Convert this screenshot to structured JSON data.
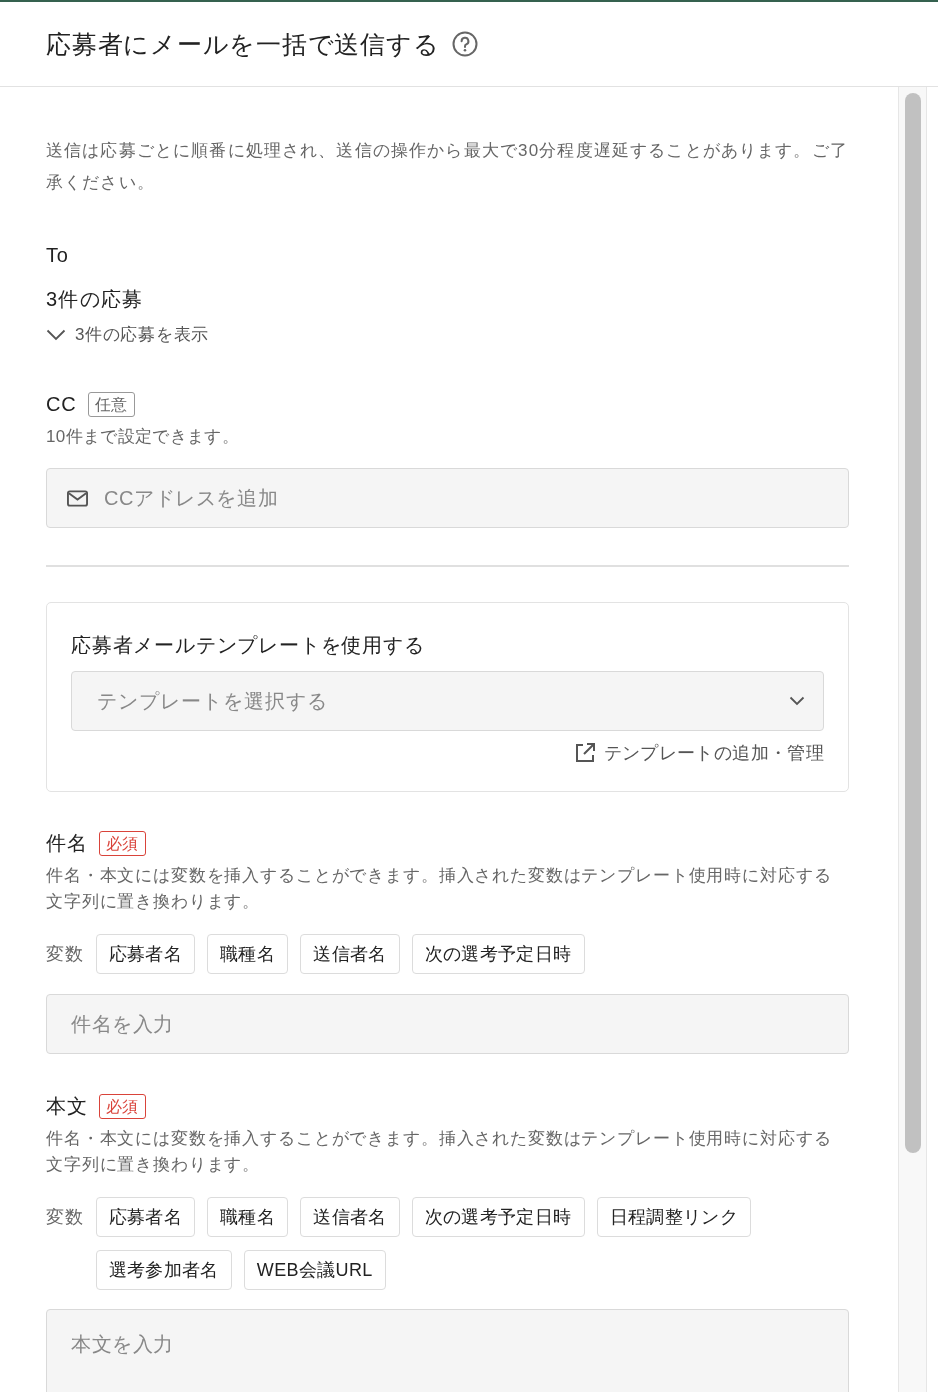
{
  "header": {
    "title": "応募者にメールを一括で送信する"
  },
  "notice": "送信は応募ごとに順番に処理され、送信の操作から最大で30分程度遅延することがあります。ご了承ください。",
  "to": {
    "label": "To",
    "summary": "3件の応募",
    "toggle": {
      "label": "3件の応募を表示",
      "expanded": false
    }
  },
  "cc": {
    "label": "CC",
    "badge": {
      "text": "任意",
      "kind": "optional"
    },
    "help": "10件まで設定できます。",
    "field": {
      "placeholder": "CCアドレスを追加"
    }
  },
  "template": {
    "title": "応募者メールテンプレートを使用する",
    "select": {
      "placeholder": "テンプレートを選択する"
    },
    "link": "テンプレートの追加・管理"
  },
  "subject": {
    "label": "件名",
    "badge": {
      "text": "必須",
      "kind": "required"
    },
    "help": "件名・本文には変数を挿入することができます。挿入された変数はテンプレート使用時に対応する文字列に置き換わります。",
    "variables_label": "変数",
    "variables": [
      "応募者名",
      "職種名",
      "送信者名",
      "次の選考予定日時"
    ],
    "field": {
      "kind": "input",
      "placeholder": "件名を入力"
    }
  },
  "body": {
    "label": "本文",
    "badge": {
      "text": "必須",
      "kind": "required"
    },
    "help": "件名・本文には変数を挿入することができます。挿入された変数はテンプレート使用時に対応する文字列に置き換わります。",
    "variables_label": "変数",
    "variables": [
      "応募者名",
      "職種名",
      "送信者名",
      "次の選考予定日時",
      "日程調整リンク",
      "選考参加者名",
      "WEB会議URL"
    ],
    "field": {
      "kind": "textarea",
      "placeholder": "本文を入力"
    }
  }
}
